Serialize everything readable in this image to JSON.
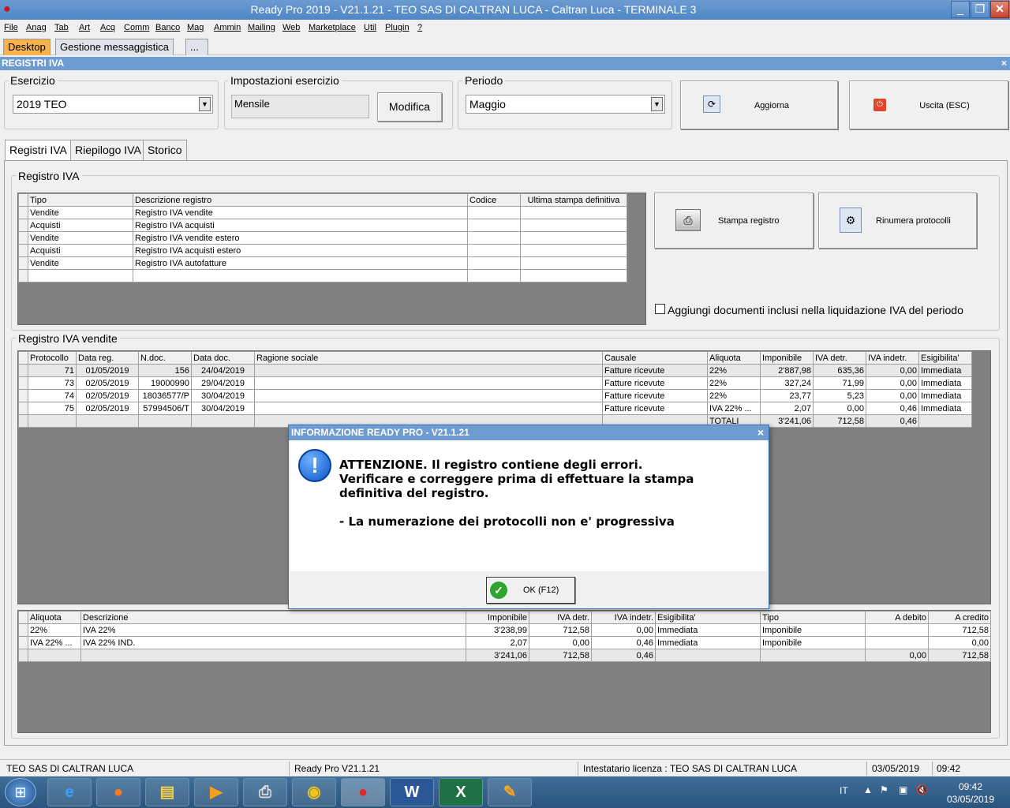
{
  "window": {
    "title": "Ready Pro 2019 - V21.1.21 - TEO SAS DI CALTRAN LUCA - Caltran Luca - TERMINALE 3",
    "controls": {
      "minimize": "_",
      "maximize": "❐",
      "close": "✕"
    }
  },
  "menu": [
    "File",
    "Anag",
    "Tab",
    "Art",
    "Acq",
    "Comm",
    "Banco",
    "Mag",
    "Ammin",
    "Mailing",
    "Web",
    "Marketplace",
    "Util",
    "Plugin",
    "?"
  ],
  "app_tabs": [
    "Desktop",
    "Gestione messaggistica",
    "..."
  ],
  "section_title": "REGISTRI IVA",
  "section_close": "×",
  "esercizio": {
    "label": "Esercizio",
    "value": "2019 TEO"
  },
  "impostazioni": {
    "label": "Impostazioni esercizio",
    "value": "Mensile",
    "button": "Modifica"
  },
  "periodo": {
    "label": "Periodo",
    "value": "Maggio"
  },
  "toolbar": {
    "aggiorna": "Aggiorna",
    "uscita": "Uscita (ESC)"
  },
  "tabs": [
    "Registri IVA",
    "Riepilogo IVA",
    "Storico"
  ],
  "registro_group": {
    "label": "Registro IVA",
    "columns": [
      "Tipo",
      "Descrizione registro",
      "Codice",
      "Ultima stampa definitiva"
    ],
    "rows": [
      [
        "Vendite",
        "Registro IVA vendite",
        "",
        ""
      ],
      [
        "Acquisti",
        "Registro IVA acquisti",
        "",
        ""
      ],
      [
        "Vendite",
        "Registro IVA vendite estero",
        "",
        ""
      ],
      [
        "Acquisti",
        "Registro IVA acquisti estero",
        "",
        ""
      ],
      [
        "Vendite",
        "Registro IVA autofatture",
        "",
        ""
      ]
    ],
    "stampa_button": "Stampa registro",
    "rinumera_button": "Rinumera protocolli",
    "checkbox_label": "Aggiungi documenti inclusi nella liquidazione IVA del periodo"
  },
  "vendite_group": {
    "label": "Registro IVA vendite",
    "columns": [
      "Protocollo",
      "Data reg.",
      "N.doc.",
      "Data doc.",
      "Ragione sociale",
      "Causale",
      "Aliquota",
      "Imponibile",
      "IVA detr.",
      "IVA indetr.",
      "Esigibilita'"
    ],
    "rows": [
      [
        "71",
        "01/05/2019",
        "156",
        "24/04/2019",
        "",
        "Fatture ricevute",
        "22%",
        "2'887,98",
        "635,36",
        "0,00",
        "Immediata"
      ],
      [
        "73",
        "02/05/2019",
        "19000990",
        "29/04/2019",
        "",
        "Fatture ricevute",
        "22%",
        "327,24",
        "71,99",
        "0,00",
        "Immediata"
      ],
      [
        "74",
        "02/05/2019",
        "18036577/P",
        "30/04/2019",
        "",
        "Fatture ricevute",
        "22%",
        "23,77",
        "5,23",
        "0,00",
        "Immediata"
      ],
      [
        "75",
        "02/05/2019",
        "57994506/T",
        "30/04/2019",
        "",
        "Fatture ricevute",
        "IVA 22% ...",
        "2,07",
        "0,00",
        "0,46",
        "Immediata"
      ]
    ],
    "total_row": {
      "label": "TOTALI",
      "imponibile": "3'241,06",
      "iva_detr": "712,58",
      "iva_indetr": "0,46"
    }
  },
  "riepilogo": {
    "columns": [
      "Aliquota",
      "Descrizione",
      "Imponibile",
      "IVA detr.",
      "IVA indetr.",
      "Esigibilita'",
      "Tipo",
      "A debito",
      "A credito"
    ],
    "rows": [
      [
        "22%",
        "IVA 22%",
        "3'238,99",
        "712,58",
        "0,00",
        "Immediata",
        "Imponibile",
        "",
        "712,58"
      ],
      [
        "IVA 22% ...",
        "IVA 22% IND.",
        "2,07",
        "0,00",
        "0,46",
        "Immediata",
        "Imponibile",
        "",
        "0,00"
      ],
      [
        "",
        "",
        "3'241,06",
        "712,58",
        "0,46",
        "",
        "",
        "0,00",
        "712,58"
      ]
    ]
  },
  "dialog": {
    "title": "INFORMAZIONE READY PRO - V21.1.21",
    "close": "×",
    "line1": "ATTENZIONE. Il registro contiene degli errori.",
    "line2": "Verificare e correggere prima di effettuare la stampa definitiva del registro.",
    "line3": "- La numerazione dei protocolli non e' progressiva",
    "ok_button": "OK (F12)"
  },
  "status": {
    "company": "TEO SAS DI CALTRAN LUCA",
    "version": "Ready Pro V21.1.21",
    "license": "Intestatario licenza : TEO SAS DI CALTRAN LUCA",
    "date": "03/05/2019",
    "time": "09:42"
  },
  "taskbar": {
    "lang": "IT",
    "clock_time": "09:42",
    "clock_date": "03/05/2019"
  },
  "colors": {
    "title_bar": "#5a8cc9",
    "grid_bg": "#808080",
    "desktop_tab": "#f7b24a"
  }
}
